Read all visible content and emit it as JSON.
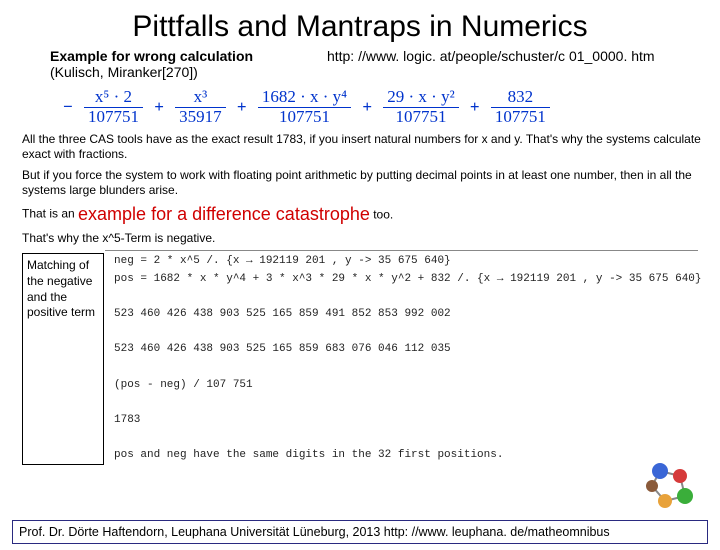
{
  "title": "Pittfalls and Mantraps in  Numerics",
  "subhead": {
    "line1": "Example for wrong calculation",
    "ref": "(Kulisch, Miranker[270])",
    "url": "http: //www. logic. at/people/schuster/c 01_0000. htm"
  },
  "formula": {
    "terms": [
      {
        "sign": "−",
        "num": "x⁵ · 2",
        "den": "107751"
      },
      {
        "sign": "+",
        "num": "x³",
        "den": "35917"
      },
      {
        "sign": "+",
        "num": "1682 · x · y⁴",
        "den": "107751"
      },
      {
        "sign": "+",
        "num": "29 · x · y²",
        "den": "107751"
      },
      {
        "sign": "+",
        "num": "832",
        "den": "107751"
      }
    ]
  },
  "para1": "All the three CAS tools have as the exact result 1783, if you insert natural numbers for x and y. That's why the systems calculate exact with fractions.",
  "para2": "But if you force the system to work with floating point arithmetic by putting decimal points in at least one number, then in all the systems large blunders arise.",
  "catline_pre": "That is an ",
  "catline_cat": "example for a difference catastrophe",
  "catline_post": "  too.",
  "para3": "That's why the x^5-Term is negative.",
  "matchbox": "Matching of the negative and the positive term",
  "calc": {
    "l1": "neg = 2 * x^5 /. {x → 192119 201 , y -> 35 675 640}",
    "l2": "pos = 1682 * x * y^4 + 3 * x^3 * 29 * x * y^2 + 832 /. {x → 192119 201 , y -> 35 675 640}",
    "l3": "523 460 426 438 903 525 165 859 491 852 853 992 002",
    "l4": "523 460 426 438 903 525 165 859 683 076 046 112 035",
    "l5": "(pos - neg) / 107 751",
    "l6": "1783",
    "l7": "pos and neg have the same digits in the 32 first positions."
  },
  "footer": "Prof. Dr. Dörte Haftendorn, Leuphana Universität Lüneburg, 2013 http: //www. leuphana. de/matheomnibus"
}
